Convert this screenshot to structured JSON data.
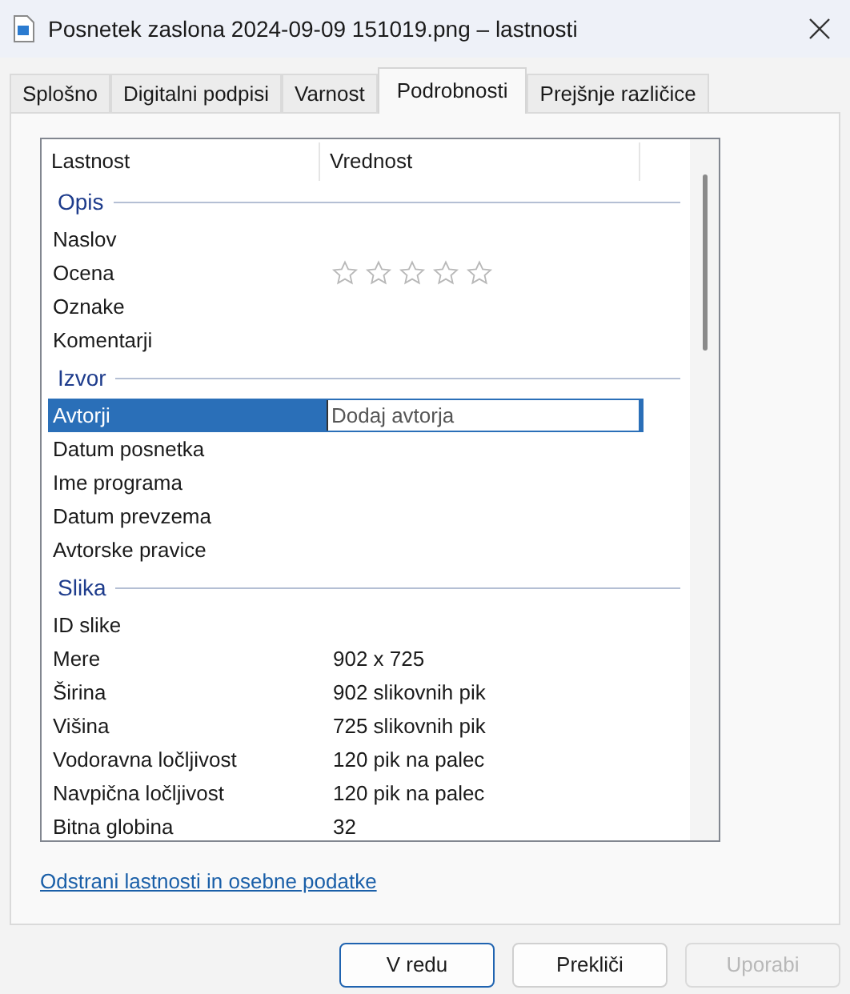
{
  "window": {
    "title": "Posnetek zaslona 2024-09-09 151019.png – lastnosti"
  },
  "tabs": [
    {
      "label": "Splošno",
      "selected": false
    },
    {
      "label": "Digitalni podpisi",
      "selected": false
    },
    {
      "label": "Varnost",
      "selected": false
    },
    {
      "label": "Podrobnosti",
      "selected": true
    },
    {
      "label": "Prejšnje različice",
      "selected": false
    }
  ],
  "table": {
    "columns": [
      "Lastnost",
      "Vrednost"
    ],
    "rows": [
      {
        "kind": "group",
        "label": "Opis"
      },
      {
        "kind": "text",
        "label": "Naslov",
        "selected": false
      },
      {
        "kind": "rating",
        "label": "Ocena",
        "stars": 0,
        "selected": false
      },
      {
        "kind": "text",
        "label": "Oznake",
        "selected": false
      },
      {
        "kind": "text",
        "label": "Komentarji",
        "selected": false
      },
      {
        "kind": "group",
        "label": "Izvor"
      },
      {
        "kind": "field",
        "label": "Avtorji",
        "placeholder": "Dodaj avtorja",
        "selected": true
      },
      {
        "kind": "text",
        "label": "Datum posnetka",
        "selected": false
      },
      {
        "kind": "text",
        "label": "Ime programa",
        "selected": false
      },
      {
        "kind": "text",
        "label": "Datum prevzema",
        "selected": false
      },
      {
        "kind": "text",
        "label": "Avtorske pravice",
        "selected": false
      },
      {
        "kind": "group",
        "label": "Slika"
      },
      {
        "kind": "text",
        "label": "ID slike",
        "selected": false
      },
      {
        "kind": "text",
        "label": "Mere",
        "value": "902 x 725",
        "selected": false
      },
      {
        "kind": "text",
        "label": "Širina",
        "value": "902 slikovnih pik",
        "selected": false
      },
      {
        "kind": "text",
        "label": "Višina",
        "value": "725 slikovnih pik",
        "selected": false
      },
      {
        "kind": "text",
        "label": "Vodoravna ločljivost",
        "value": "120 pik na palec",
        "selected": false
      },
      {
        "kind": "text",
        "label": "Navpična ločljivost",
        "value": "120 pik na palec",
        "selected": false
      },
      {
        "kind": "text",
        "label": "Bitna globina",
        "value": "32",
        "selected": false
      }
    ]
  },
  "link": "Odstrani lastnosti in osebne podatke",
  "buttons": [
    {
      "label": "V redu",
      "kind": "default",
      "disabled": false
    },
    {
      "label": "Prekliči",
      "kind": "normal",
      "disabled": false
    },
    {
      "label": "Uporabi",
      "kind": "normal",
      "disabled": true
    }
  ]
}
